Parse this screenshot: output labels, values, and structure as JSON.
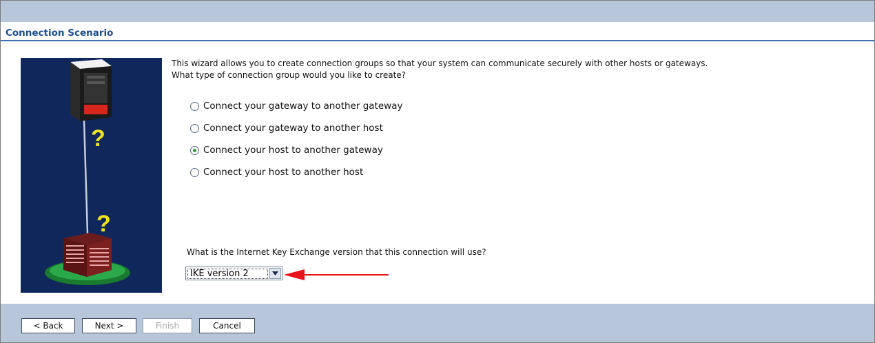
{
  "page": {
    "section_title": "Connection Scenario"
  },
  "intro": {
    "line1": "This wizard allows you to create connection groups so that your system can communicate securely with other hosts or gateways.",
    "line2": "What type of connection group would you like to create?"
  },
  "options": [
    {
      "label": "Connect your gateway to another gateway",
      "selected": false
    },
    {
      "label": "Connect your gateway to another host",
      "selected": false
    },
    {
      "label": "Connect your host to another gateway",
      "selected": true
    },
    {
      "label": "Connect your host to another host",
      "selected": false
    }
  ],
  "ike": {
    "question": "What is the Internet Key Exchange version that this connection will use?",
    "selected": "IKE version 2"
  },
  "buttons": {
    "back": "< Back",
    "next": "Next >",
    "finish": "Finish",
    "cancel": "Cancel"
  },
  "colors": {
    "header_band": "#b7c6d8",
    "title_text": "#1c4f8f",
    "illustration_bg": "#10275c",
    "annotation_arrow": "#e8121b",
    "radio_selected": "#2f9a3a"
  },
  "icons": {
    "illustration": "server-to-building-connection-illustration",
    "dropdown": "chevron-down-icon",
    "annotation": "red-arrow-icon"
  }
}
